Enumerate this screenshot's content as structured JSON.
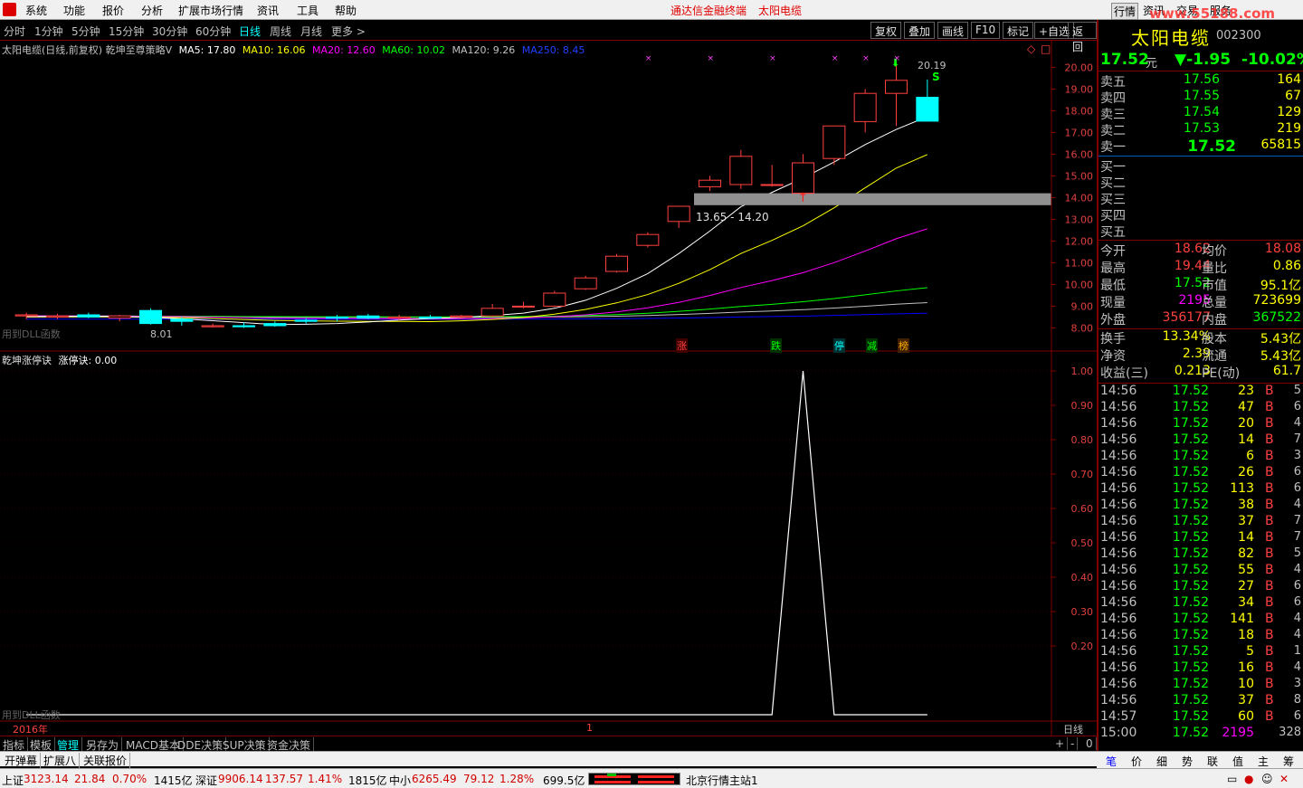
{
  "menu": {
    "items": [
      "系统",
      "功能",
      "报价",
      "分析",
      "扩展市场行情",
      "资讯",
      "工具",
      "帮助"
    ],
    "center_title": "通达信金融终端",
    "center_stock": "太阳电缆",
    "right_buttons": [
      "行情",
      "资讯",
      "交易",
      "服务"
    ],
    "watermark": "www.55188.com"
  },
  "tabs": {
    "periods": [
      "分时",
      "1分钟",
      "5分钟",
      "15分钟",
      "30分钟",
      "60分钟",
      "日线",
      "周线",
      "月线",
      "更多 >"
    ],
    "active": "日线",
    "buttons": [
      "复权",
      "叠加",
      "画线",
      "F10",
      "标记",
      "+自选",
      "返回"
    ]
  },
  "chart_info": {
    "title": "太阳电缆(日线,前复权) 乾坤至尊策略V",
    "ma5": "MA5: 17.80",
    "ma10": "MA10: 16.06",
    "ma20": "MA20: 12.60",
    "ma60": "MA60: 10.02",
    "ma120": "MA120: 9.26",
    "ma250": "MA250: 8.45",
    "high_label": "20.19",
    "low_label": "8.01",
    "range_label": "13.65 - 14.20",
    "dll_notice": "用到DLL函数",
    "markers": [
      "涨",
      "跌",
      "停",
      "减",
      "榜"
    ],
    "s_label": "S"
  },
  "indicator_info": {
    "title": "乾坤涨停诀",
    "value": "涨停诀: 0.00",
    "dll_notice": "用到DLL函数"
  },
  "chart_data": [
    {
      "type": "candlestick",
      "ylim": [
        7.6,
        20.6
      ],
      "yticks": [
        "20.00",
        "19.00",
        "18.00",
        "17.00",
        "16.00",
        "15.00",
        "14.00",
        "13.00",
        "12.00",
        "11.00",
        "10.00",
        "9.00",
        "8.00"
      ],
      "candles": [
        {
          "o": 8.55,
          "h": 8.7,
          "l": 8.4,
          "c": 8.6
        },
        {
          "o": 8.5,
          "h": 8.65,
          "l": 8.4,
          "c": 8.55
        },
        {
          "o": 8.6,
          "h": 8.7,
          "l": 8.45,
          "c": 8.5
        },
        {
          "o": 8.45,
          "h": 8.6,
          "l": 8.3,
          "c": 8.55
        },
        {
          "o": 8.8,
          "h": 8.9,
          "l": 8.15,
          "c": 8.2
        },
        {
          "o": 8.4,
          "h": 8.5,
          "l": 8.1,
          "c": 8.3
        },
        {
          "o": 8.05,
          "h": 8.2,
          "l": 8.01,
          "c": 8.1
        },
        {
          "o": 8.1,
          "h": 8.25,
          "l": 8.0,
          "c": 8.05
        },
        {
          "o": 8.2,
          "h": 8.3,
          "l": 8.05,
          "c": 8.1
        },
        {
          "o": 8.35,
          "h": 8.45,
          "l": 8.2,
          "c": 8.3
        },
        {
          "o": 8.5,
          "h": 8.6,
          "l": 8.3,
          "c": 8.45
        },
        {
          "o": 8.55,
          "h": 8.65,
          "l": 8.4,
          "c": 8.45
        },
        {
          "o": 8.45,
          "h": 8.6,
          "l": 8.35,
          "c": 8.5
        },
        {
          "o": 8.5,
          "h": 8.6,
          "l": 8.4,
          "c": 8.45
        },
        {
          "o": 8.5,
          "h": 8.6,
          "l": 8.4,
          "c": 8.55
        },
        {
          "o": 8.55,
          "h": 9.1,
          "l": 8.5,
          "c": 8.9
        },
        {
          "o": 9.0,
          "h": 9.2,
          "l": 8.9,
          "c": 9.0
        },
        {
          "o": 9.0,
          "h": 9.7,
          "l": 8.95,
          "c": 9.6
        },
        {
          "o": 9.8,
          "h": 10.4,
          "l": 9.75,
          "c": 10.3
        },
        {
          "o": 10.6,
          "h": 11.4,
          "l": 10.55,
          "c": 11.3
        },
        {
          "o": 11.8,
          "h": 12.4,
          "l": 11.7,
          "c": 12.3
        },
        {
          "o": 12.9,
          "h": 13.6,
          "l": 12.6,
          "c": 13.6
        },
        {
          "o": 14.5,
          "h": 15.0,
          "l": 14.3,
          "c": 14.8
        },
        {
          "o": 14.6,
          "h": 16.2,
          "l": 14.4,
          "c": 15.9
        },
        {
          "o": 14.6,
          "h": 15.5,
          "l": 14.5,
          "c": 14.6
        },
        {
          "o": 14.2,
          "h": 16.0,
          "l": 14.0,
          "c": 15.6
        },
        {
          "o": 15.8,
          "h": 17.3,
          "l": 15.5,
          "c": 17.3
        },
        {
          "o": 17.5,
          "h": 19.0,
          "l": 17.0,
          "c": 18.8
        },
        {
          "o": 18.8,
          "h": 20.19,
          "l": 17.3,
          "c": 19.4
        },
        {
          "o": 18.62,
          "h": 19.44,
          "l": 17.52,
          "c": 17.52
        }
      ],
      "ma_colors": {
        "ma5": "#ffffff",
        "ma10": "#ffff00",
        "ma20": "#ff00ff",
        "ma60": "#00ff00",
        "ma120": "#c0c0c0",
        "ma250": "#0000ff"
      }
    },
    {
      "type": "line",
      "title": "乾坤涨停诀",
      "ylim": [
        0,
        1.05
      ],
      "yticks": [
        "1.00",
        "0.90",
        "0.80",
        "0.70",
        "0.60",
        "0.50",
        "0.40",
        "0.30",
        "0.20"
      ],
      "values": [
        0,
        0,
        0,
        0,
        0,
        0,
        0,
        0,
        0,
        0,
        0,
        0,
        0,
        0,
        0,
        0,
        0,
        0,
        0,
        0,
        0,
        0,
        0,
        0,
        0,
        1,
        0,
        0,
        0,
        0
      ]
    }
  ],
  "bottom_axis": {
    "year": "2016年",
    "marker": "1",
    "period": "日线"
  },
  "toolbar2": [
    "指标",
    "模板",
    "管理",
    "另存为",
    "MACD基本",
    "DDE决策",
    "SUP决策",
    "资金决策"
  ],
  "toolbar2_right": [
    "+",
    "-",
    "0"
  ],
  "toolbar3": [
    "开弹幕",
    "扩展八",
    "关联报价"
  ],
  "stock": {
    "name": "太阳电缆",
    "code": "002300",
    "price": "17.52",
    "unit": "元",
    "change": "▼-1.95",
    "pct": "-10.02%"
  },
  "orderbook": {
    "asks": [
      {
        "label": "卖五",
        "price": "17.56",
        "vol": "164"
      },
      {
        "label": "卖四",
        "price": "17.55",
        "vol": "67"
      },
      {
        "label": "卖三",
        "price": "17.54",
        "vol": "129"
      },
      {
        "label": "卖二",
        "price": "17.53",
        "vol": "219"
      },
      {
        "label": "卖一",
        "price": "17.52",
        "vol": "65815"
      }
    ],
    "bids": [
      {
        "label": "买一",
        "price": "",
        "vol": ""
      },
      {
        "label": "买二",
        "price": "",
        "vol": ""
      },
      {
        "label": "买三",
        "price": "",
        "vol": ""
      },
      {
        "label": "买四",
        "price": "",
        "vol": ""
      },
      {
        "label": "买五",
        "price": "",
        "vol": ""
      }
    ]
  },
  "stats": [
    {
      "l1": "今开",
      "v1": "18.62",
      "l2": "均价",
      "v2": "18.08"
    },
    {
      "l1": "最高",
      "v1": "19.44",
      "l2": "量比",
      "v2": "0.86"
    },
    {
      "l1": "最低",
      "v1": "17.52",
      "l2": "市值",
      "v2": "95.1亿"
    },
    {
      "l1": "现量",
      "v1": "2195",
      "l2": "总量",
      "v2": "723699"
    },
    {
      "l1": "外盘",
      "v1": "356177",
      "l2": "内盘",
      "v2": "367522"
    },
    {
      "l1": "换手",
      "v1": "13.34%",
      "l2": "股本",
      "v2": "5.43亿"
    },
    {
      "l1": "净资",
      "v1": "2.39",
      "l2": "流通",
      "v2": "5.43亿"
    },
    {
      "l1": "收益(三)",
      "v1": "0.213",
      "l2": "PE(动)",
      "v2": "61.7"
    }
  ],
  "ticks": [
    {
      "t": "14:56",
      "p": "17.52",
      "v": "23",
      "d": "B",
      "n": "5"
    },
    {
      "t": "14:56",
      "p": "17.52",
      "v": "47",
      "d": "B",
      "n": "6"
    },
    {
      "t": "14:56",
      "p": "17.52",
      "v": "20",
      "d": "B",
      "n": "4"
    },
    {
      "t": "14:56",
      "p": "17.52",
      "v": "14",
      "d": "B",
      "n": "7"
    },
    {
      "t": "14:56",
      "p": "17.52",
      "v": "6",
      "d": "B",
      "n": "3"
    },
    {
      "t": "14:56",
      "p": "17.52",
      "v": "26",
      "d": "B",
      "n": "6"
    },
    {
      "t": "14:56",
      "p": "17.52",
      "v": "113",
      "d": "B",
      "n": "6"
    },
    {
      "t": "14:56",
      "p": "17.52",
      "v": "38",
      "d": "B",
      "n": "4"
    },
    {
      "t": "14:56",
      "p": "17.52",
      "v": "37",
      "d": "B",
      "n": "7"
    },
    {
      "t": "14:56",
      "p": "17.52",
      "v": "14",
      "d": "B",
      "n": "7"
    },
    {
      "t": "14:56",
      "p": "17.52",
      "v": "82",
      "d": "B",
      "n": "5"
    },
    {
      "t": "14:56",
      "p": "17.52",
      "v": "55",
      "d": "B",
      "n": "4"
    },
    {
      "t": "14:56",
      "p": "17.52",
      "v": "27",
      "d": "B",
      "n": "6"
    },
    {
      "t": "14:56",
      "p": "17.52",
      "v": "34",
      "d": "B",
      "n": "6"
    },
    {
      "t": "14:56",
      "p": "17.52",
      "v": "141",
      "d": "B",
      "n": "4"
    },
    {
      "t": "14:56",
      "p": "17.52",
      "v": "18",
      "d": "B",
      "n": "4"
    },
    {
      "t": "14:56",
      "p": "17.52",
      "v": "5",
      "d": "B",
      "n": "1"
    },
    {
      "t": "14:56",
      "p": "17.52",
      "v": "16",
      "d": "B",
      "n": "4"
    },
    {
      "t": "14:56",
      "p": "17.52",
      "v": "10",
      "d": "B",
      "n": "3"
    },
    {
      "t": "14:56",
      "p": "17.52",
      "v": "37",
      "d": "B",
      "n": "8"
    },
    {
      "t": "14:57",
      "p": "17.52",
      "v": "60",
      "d": "B",
      "n": "6"
    },
    {
      "t": "15:00",
      "p": "17.52",
      "v": "2195",
      "d": "",
      "n": "328"
    }
  ],
  "right_tabs": [
    "笔",
    "价",
    "细",
    "势",
    "联",
    "值",
    "主",
    "筹"
  ],
  "status": {
    "sh_label": "上证",
    "sh_val": "3123.14",
    "sh_chg": "21.84",
    "sh_pct": "0.70%",
    "sh_amt": "1415亿",
    "sz_label": "深证",
    "sz_val": "9906.14",
    "sz_chg": "137.57",
    "sz_pct": "1.41%",
    "sz_amt": "1815亿",
    "zx_label": "中小",
    "zx_val": "6265.49",
    "zx_chg": "79.12",
    "zx_pct": "1.28%",
    "zx_amt": "699.5亿",
    "server": "北京行情主站1"
  }
}
